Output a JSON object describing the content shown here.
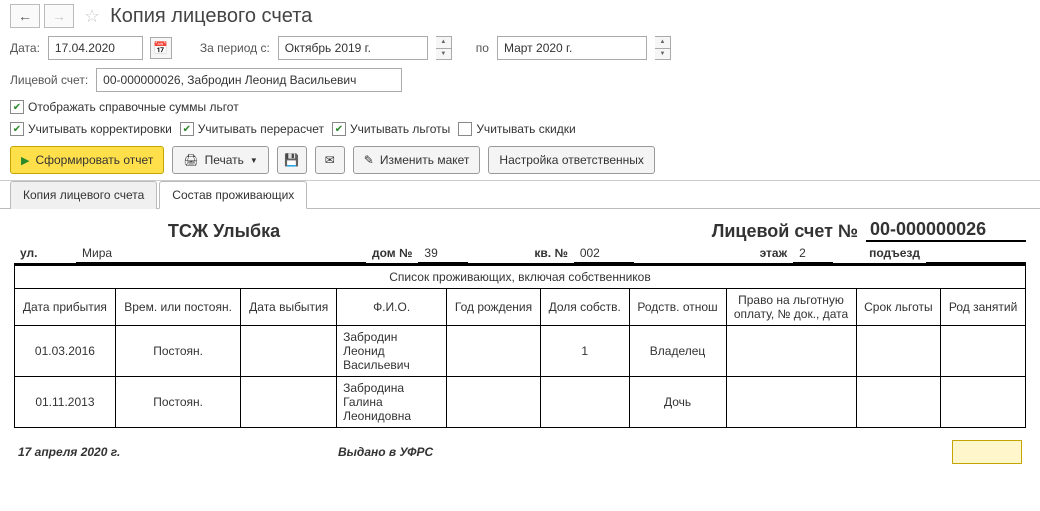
{
  "header": {
    "title": "Копия лицевого счета"
  },
  "filters": {
    "date_label": "Дата:",
    "date_value": "17.04.2020",
    "period_from_label": "За период с:",
    "period_from_value": "Октябрь 2019 г.",
    "period_to_label": "по",
    "period_to_value": "Март 2020 г.",
    "account_label": "Лицевой счет:",
    "account_value": "00-000000026, Забродин Леонид Васильевич"
  },
  "checkboxes": {
    "benefits_ref": "Отображать справочные суммы льгот",
    "corrections": "Учитывать корректировки",
    "recalc": "Учитывать перерасчет",
    "benefits": "Учитывать льготы",
    "discounts": "Учитывать скидки"
  },
  "toolbar": {
    "form_report": "Сформировать отчет",
    "print": "Печать",
    "edit_layout": "Изменить макет",
    "resp_settings": "Настройка ответственных"
  },
  "tabs": {
    "tab1": "Копия лицевого счета",
    "tab2": "Состав проживающих"
  },
  "report": {
    "company": "ТСЖ Улыбка",
    "account_label": "Лицевой счет  №",
    "account_no": "00-000000026",
    "street_label": "ул.",
    "street": "Мира",
    "house_label": "дом №",
    "house": "39",
    "apt_label": "кв. №",
    "apt": "002",
    "floor_label": "этаж",
    "floor": "2",
    "entrance_label": "подъезд",
    "entrance": "",
    "section_title": "Список проживающих, включая собственников",
    "columns": {
      "arrival": "Дата прибытия",
      "temp": "Врем. или постоян.",
      "departure": "Дата выбытия",
      "fio": "Ф.И.О.",
      "birth": "Год рождения",
      "share": "Доля собств.",
      "relation": "Родств. отнош",
      "benefits_doc": "Право на льготную оплату, № док., дата",
      "benefit_term": "Срок льготы",
      "occupation": "Род занятий"
    },
    "rows": [
      {
        "arrival": "01.03.2016",
        "temp": "Постоян.",
        "departure": "",
        "fio": "Забродин Леонид Васильевич",
        "birth": "",
        "share": "1",
        "relation": "Владелец",
        "benefits_doc": "",
        "benefit_term": "",
        "occupation": ""
      },
      {
        "arrival": "01.11.2013",
        "temp": "Постоян.",
        "departure": "",
        "fio": "Забродина Галина Леонидовна",
        "birth": "",
        "share": "",
        "relation": "Дочь",
        "benefits_doc": "",
        "benefit_term": "",
        "occupation": ""
      }
    ],
    "issue_date": "17 апреля 2020 г.",
    "issued_by": "Выдано в УФРС"
  }
}
